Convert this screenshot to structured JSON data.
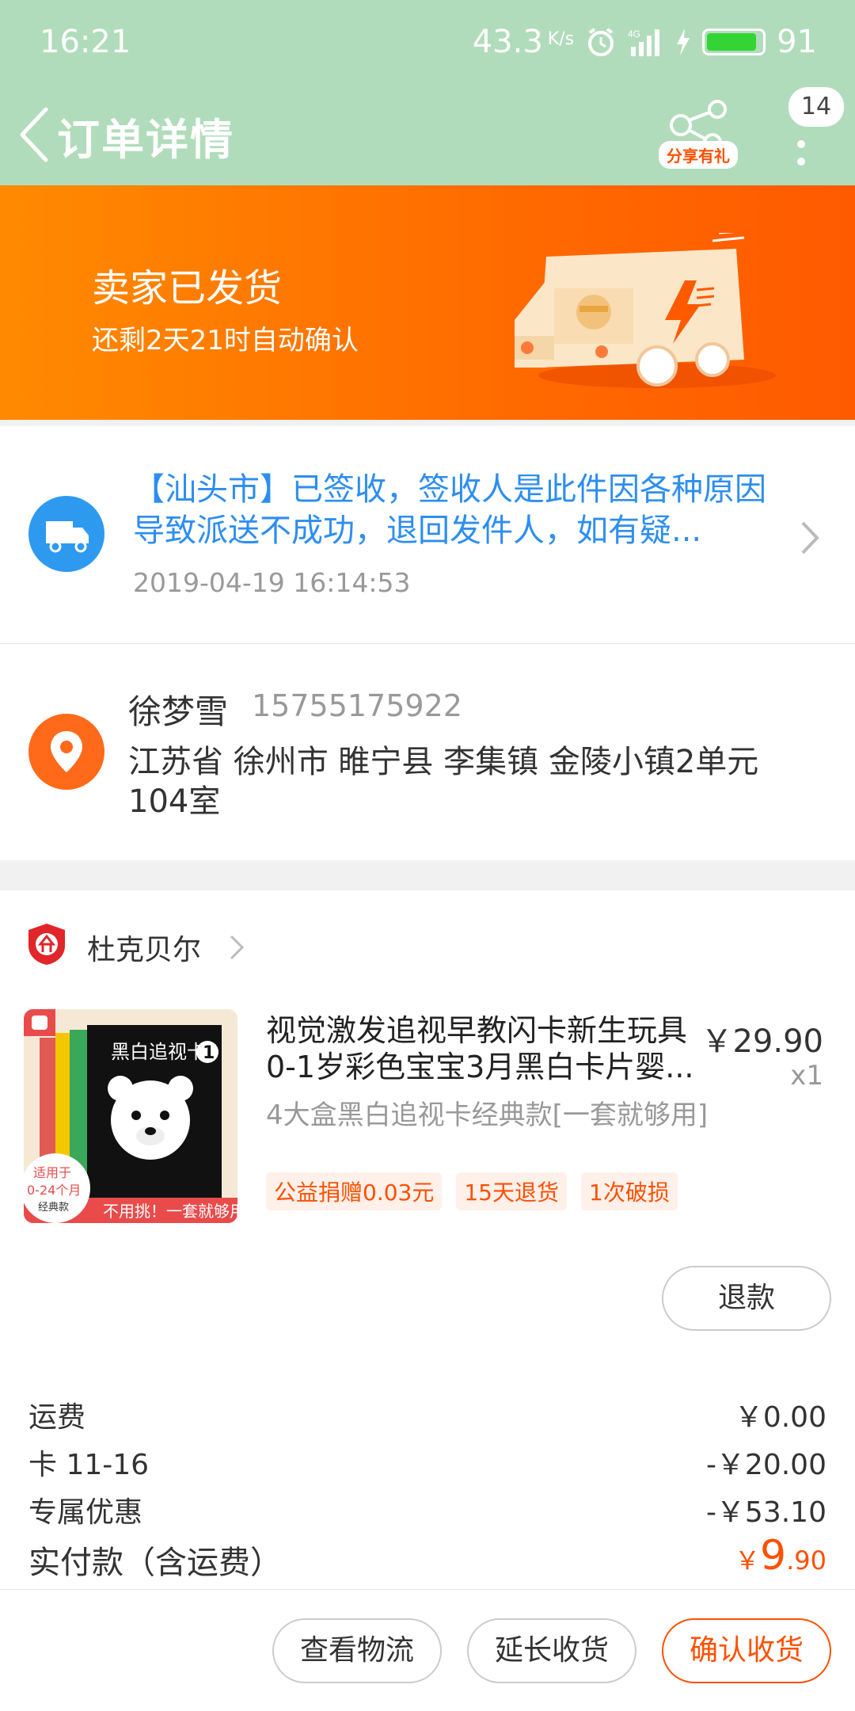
{
  "status_bar": {
    "time": "16:21",
    "speed": "43.3",
    "speed_unit": "K/s",
    "network": "4G",
    "battery": "91"
  },
  "nav": {
    "title": "订单详情",
    "share_label": "分享有礼",
    "message_count": "14"
  },
  "banner": {
    "status": "卖家已发货",
    "countdown": "还剩2天21时自动确认"
  },
  "logistics": {
    "text": "【汕头市】已签收，签收人是此件因各种原因导致派送不成功，退回发件人，如有疑...",
    "time": "2019-04-19 16:14:53"
  },
  "address": {
    "name": "徐梦雪",
    "phone": "15755175922",
    "full": "江苏省 徐州市 睢宁县 李集镇 金陵小镇2单元104室"
  },
  "shop": {
    "name": "杜克贝尔"
  },
  "item": {
    "title": "视觉激发追视早教闪卡新生玩具0-1岁彩色宝宝3月黑白卡片婴...",
    "price": "￥29.90",
    "quantity": "x1",
    "spec": "4大盒黑白追视卡经典款[一套就够用]",
    "tags": [
      "公益捐赠0.03元",
      "15天退货",
      "1次破损"
    ],
    "thumb": {
      "box_title": "黑白追视卡",
      "box_number": "1",
      "corner_line1": "适用于",
      "corner_line2": "0-24个月",
      "corner_line3": "经典款",
      "slogan": "不用挑！一套就够用"
    },
    "refund_label": "退款"
  },
  "fees": [
    {
      "label": "运费",
      "value": "￥0.00"
    },
    {
      "label": "卡 11-16",
      "value": "-￥20.00"
    },
    {
      "label": "专属优惠",
      "value": "-￥53.10"
    }
  ],
  "total": {
    "label": "实付款（含运费）",
    "currency": "￥",
    "integer": "9",
    "decimal": ".90"
  },
  "actions": {
    "logistics": "查看物流",
    "extend": "延长收货",
    "confirm": "确认收货"
  },
  "colors": {
    "header": "#b1dcbb",
    "accent": "#ff5000",
    "logistics_blue": "#2d8ef0"
  }
}
